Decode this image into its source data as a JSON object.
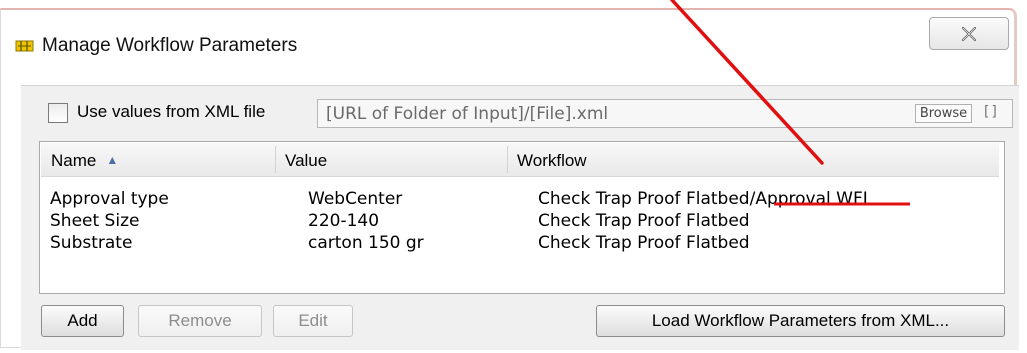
{
  "window": {
    "title": "Manage Workflow Parameters",
    "title_icon": "parameters-icon",
    "close_icon": "close-x-icon"
  },
  "xml_source": {
    "checkbox_checked": false,
    "label": "Use values from XML file",
    "url_value": "[URL of Folder of Input]/[File].xml",
    "browse_label": "Browse",
    "extra_button": "[]"
  },
  "table": {
    "columns": [
      "Name",
      "Value",
      "Workflow"
    ],
    "sort_column": "Name",
    "sort_icon": "sort-ascending-icon",
    "rows": [
      {
        "name": "Approval type",
        "value": "WebCenter",
        "workflow_prefix": "Check Trap Proof Flatbed/",
        "workflow_suffix": "Approval WFL"
      },
      {
        "name": "Sheet Size",
        "value": "220-140",
        "workflow_prefix": "Check Trap Proof Flatbed",
        "workflow_suffix": ""
      },
      {
        "name": "Substrate",
        "value": "carton 150 gr",
        "workflow_prefix": "Check Trap Proof Flatbed",
        "workflow_suffix": ""
      }
    ]
  },
  "buttons": {
    "add": "Add",
    "remove": "Remove",
    "edit": "Edit",
    "load": "Load Workflow Parameters from XML..."
  },
  "annotation": {
    "color": "#e01010",
    "type": "red-arrow-and-underline"
  }
}
